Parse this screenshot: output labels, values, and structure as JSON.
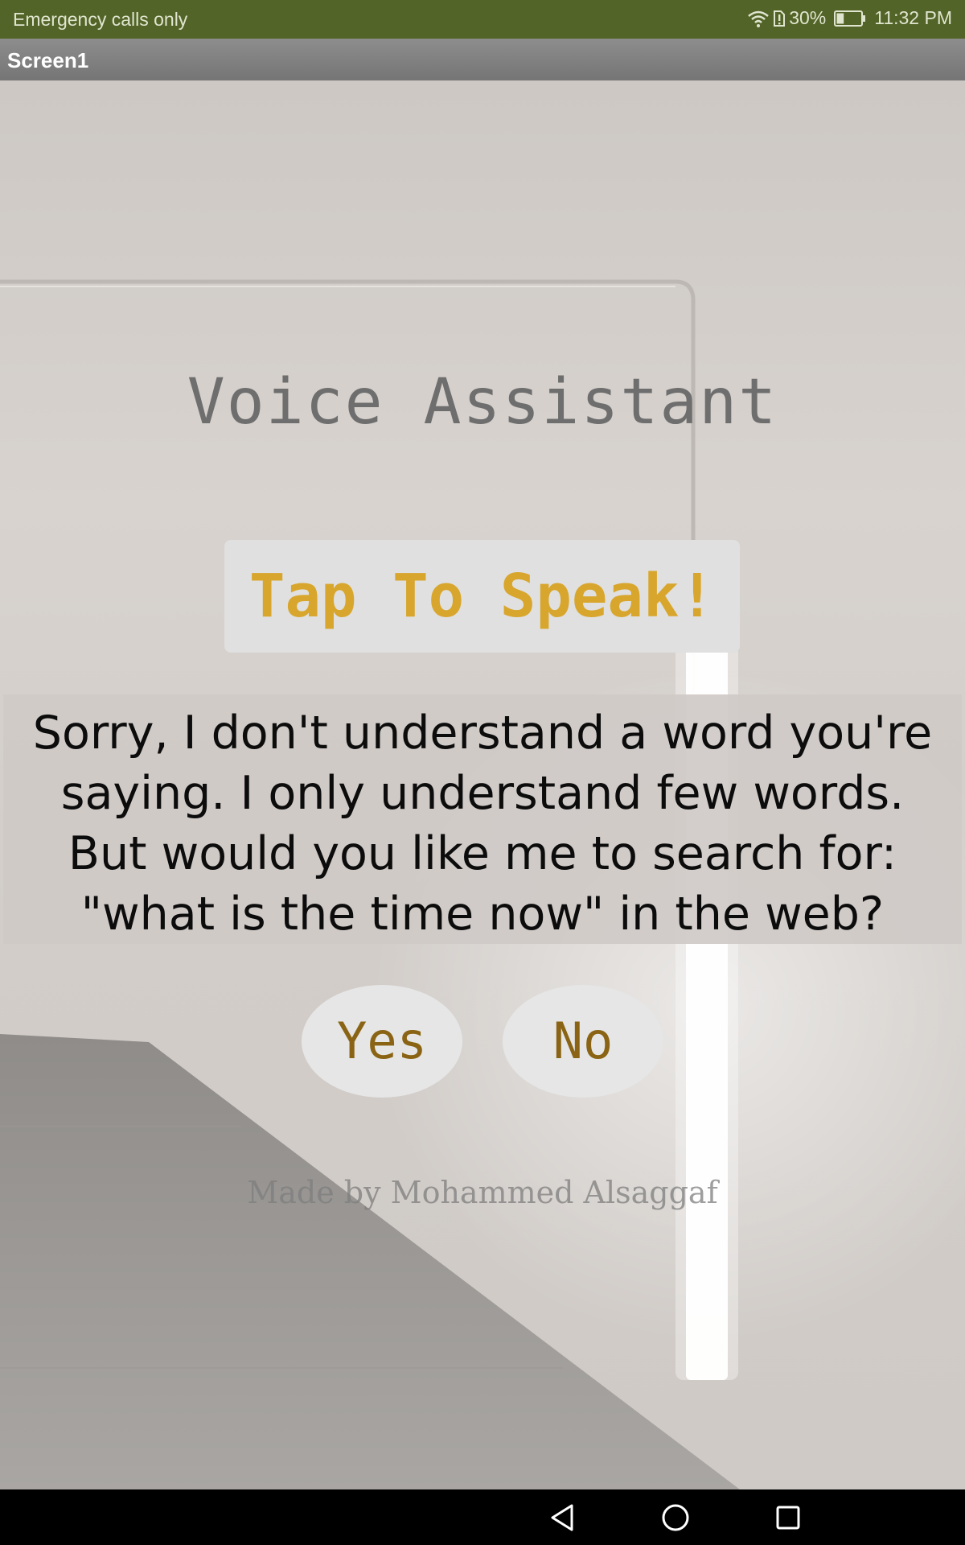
{
  "status_bar": {
    "carrier_text": "Emergency calls only",
    "battery_percent": "30%",
    "battery_level": 0.3,
    "time": "11:32 PM",
    "icons": [
      "wifi-icon",
      "sim-alert-icon",
      "battery-icon"
    ]
  },
  "title_bar": {
    "title": "Screen1"
  },
  "main": {
    "app_title": "Voice Assistant",
    "speak_button_label": "Tap To Speak!",
    "response_text": "Sorry, I don't understand a word you're saying. I only understand few words. But would you like me to search for: \"what is the time now\" in the web?",
    "yes_label": "Yes",
    "no_label": "No",
    "credit": "Made by Mohammed Alsaggaf"
  },
  "nav_bar": {
    "icons": [
      "back-icon",
      "home-icon",
      "recent-apps-icon"
    ]
  },
  "colors": {
    "status_bar": "#536428",
    "title_bar": "#7f7f7f",
    "speak_label": "#d8a62c",
    "yes_no_label": "#8a6414",
    "app_title": "#6e6e6e"
  }
}
